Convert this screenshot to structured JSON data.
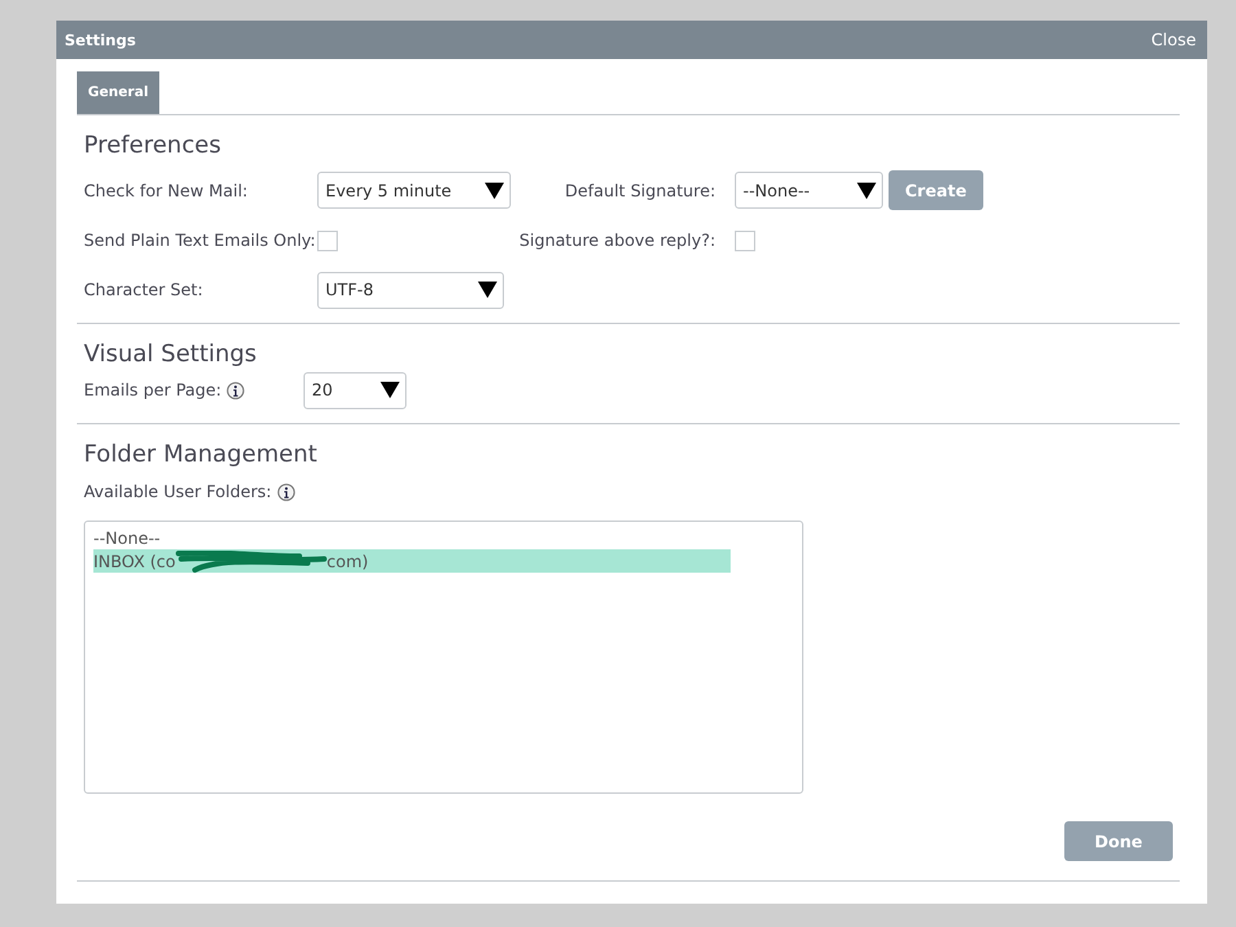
{
  "window": {
    "title": "Settings",
    "close": "Close"
  },
  "tabs": [
    {
      "label": "General",
      "selected": true
    }
  ],
  "preferences": {
    "heading": "Preferences",
    "check_mail": {
      "label": "Check for New Mail:",
      "value": "Every 5 minute"
    },
    "default_signature": {
      "label": "Default Signature:",
      "value": "--None--",
      "button": "Create"
    },
    "plain_text": {
      "label": "Send Plain Text Emails Only:",
      "checked": false
    },
    "signature_above": {
      "label": "Signature above reply?:",
      "checked": false
    },
    "charset": {
      "label": "Character Set:",
      "value": "UTF-8"
    }
  },
  "visual": {
    "heading": "Visual Settings",
    "emails_per_page": {
      "label": "Emails per Page:",
      "value": "20"
    }
  },
  "folders": {
    "heading": "Folder Management",
    "label": "Available User Folders:",
    "items": [
      {
        "prefix": "--None--",
        "selected": false
      },
      {
        "prefix": "INBOX (co",
        "suffix": "com)",
        "redacted": true,
        "selected": true
      }
    ]
  },
  "done": "Done"
}
